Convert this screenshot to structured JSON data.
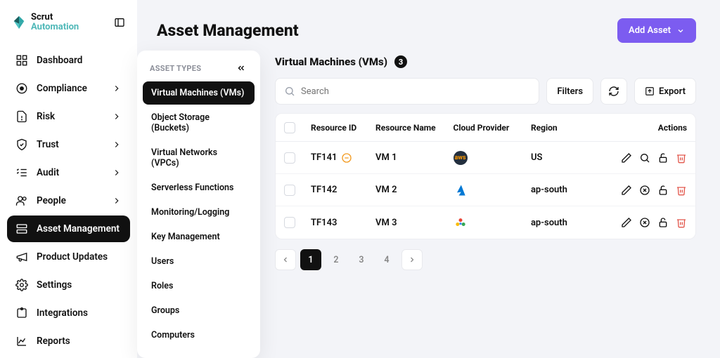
{
  "brand": {
    "name": "Scrut",
    "sub": "Automation"
  },
  "sidebar": [
    {
      "label": "Dashboard",
      "icon": "grid",
      "expandable": false
    },
    {
      "label": "Compliance",
      "icon": "circle-dot",
      "expandable": true
    },
    {
      "label": "Risk",
      "icon": "file-alert",
      "expandable": true
    },
    {
      "label": "Trust",
      "icon": "shield-check",
      "expandable": true
    },
    {
      "label": "Audit",
      "icon": "list-check",
      "expandable": true
    },
    {
      "label": "People",
      "icon": "users",
      "expandable": true
    },
    {
      "label": "Asset Management",
      "icon": "layout-list",
      "expandable": false,
      "active": true
    },
    {
      "label": "Product Updates",
      "icon": "megaphone",
      "expandable": false
    },
    {
      "label": "Settings",
      "icon": "gear",
      "expandable": false
    },
    {
      "label": "Integrations",
      "icon": "puzzle",
      "expandable": false
    },
    {
      "label": "Reports",
      "icon": "chart",
      "expandable": false
    }
  ],
  "types": {
    "header": "ASSET TYPES",
    "items": [
      {
        "label": "Virtual Machines (VMs)",
        "active": true
      },
      {
        "label": "Object Storage (Buckets)"
      },
      {
        "label": "Virtual Networks (VPCs)"
      },
      {
        "label": "Serverless Functions"
      },
      {
        "label": "Monitoring/Logging"
      },
      {
        "label": "Key Management"
      },
      {
        "label": "Users"
      },
      {
        "label": "Roles"
      },
      {
        "label": "Groups"
      },
      {
        "label": "Computers"
      }
    ]
  },
  "page": {
    "title": "Asset Management",
    "add_label": "Add Asset",
    "section_title": "Virtual Machines (VMs)",
    "count": "3",
    "search_placeholder": "Search",
    "filters_label": "Filters",
    "export_label": "Export"
  },
  "table": {
    "headers": {
      "resource_id": "Resource ID",
      "resource_name": "Resource Name",
      "cloud_provider": "Cloud Provider",
      "region": "Region",
      "actions": "Actions"
    },
    "rows": [
      {
        "id": "TF141",
        "name": "VM 1",
        "provider": "aws",
        "region": "US",
        "warn": true
      },
      {
        "id": "TF142",
        "name": "VM 2",
        "provider": "azure",
        "region": "ap-south",
        "warn": false
      },
      {
        "id": "TF143",
        "name": "VM 3",
        "provider": "gcp",
        "region": "ap-south",
        "warn": false
      }
    ]
  },
  "pagination": {
    "pages": [
      "1",
      "2",
      "3",
      "4"
    ],
    "active": "1"
  }
}
